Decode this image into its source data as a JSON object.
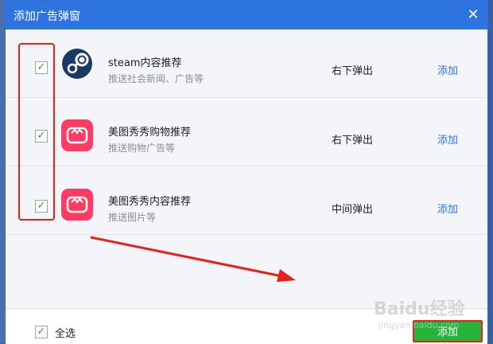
{
  "dialog": {
    "title": "添加广告弹窗",
    "close_glyph": "✕"
  },
  "items": [
    {
      "name": "steam内容推荐",
      "desc": "推送社会新闻、广告等",
      "mode": "右下弹出",
      "action": "添加",
      "checked": true,
      "icon": "steam-icon"
    },
    {
      "name": "美图秀秀购物推荐",
      "desc": "推送购物广告等",
      "mode": "右下弹出",
      "action": "添加",
      "checked": true,
      "icon": "meitu-icon"
    },
    {
      "name": "美图秀秀内容推荐",
      "desc": "推送图片等",
      "mode": "中间弹出",
      "action": "添加",
      "checked": true,
      "icon": "meitu-icon"
    }
  ],
  "footer": {
    "select_all_label": "全选",
    "select_all_checked": true,
    "add_button": "添加"
  },
  "check_glyph": "✓",
  "watermark": {
    "brand": "Baidu经验",
    "url": "jingyan.baidu.com"
  },
  "colors": {
    "titlebar": "#2e74e0",
    "link": "#2e74e0",
    "add_button": "#26b53a",
    "annotation": "#e8201a",
    "meitu_icon": "#ff3b63"
  }
}
